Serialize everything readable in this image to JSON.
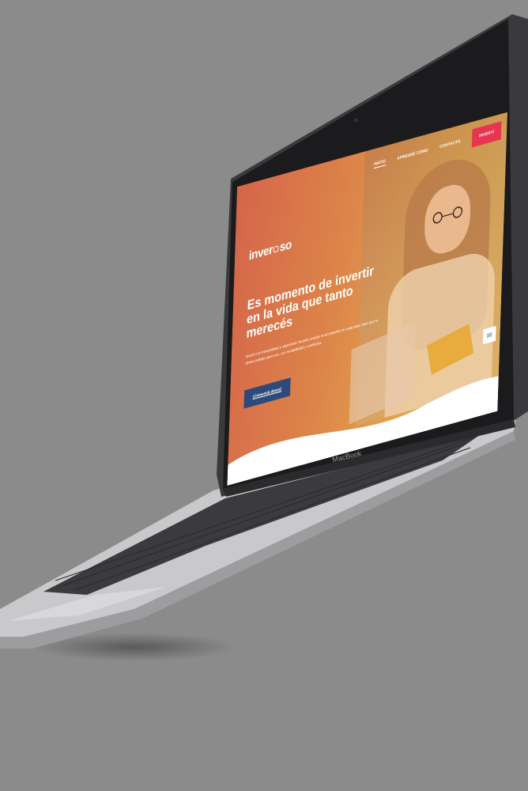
{
  "device": {
    "brand_label": "MacBook"
  },
  "site": {
    "logo": {
      "text_left": "inver",
      "text_right": "so"
    },
    "nav": {
      "items": [
        {
          "label": "INICIO",
          "active": true
        },
        {
          "label": "APRENDÉ CÓMO",
          "active": false
        },
        {
          "label": "CONTACTO",
          "active": false
        }
      ],
      "cta_label": "INVERTÍ"
    },
    "hero": {
      "title": "Es momento de invertir en la vida que tanto merecés",
      "text": "Invertí con tranquilidad y seguridad. Nuestro equipo te acompaña en cada paso para que tu dinero trabaje para vos, con rentabilidad y confianza.",
      "button_label": "¡Comenzá ahora!"
    },
    "mail_icon": "mail-icon",
    "colors": {
      "gradient_start": "#d5654a",
      "gradient_end": "#e7b95a",
      "cta": "#e7344f",
      "button": "#2e4a7a"
    }
  }
}
